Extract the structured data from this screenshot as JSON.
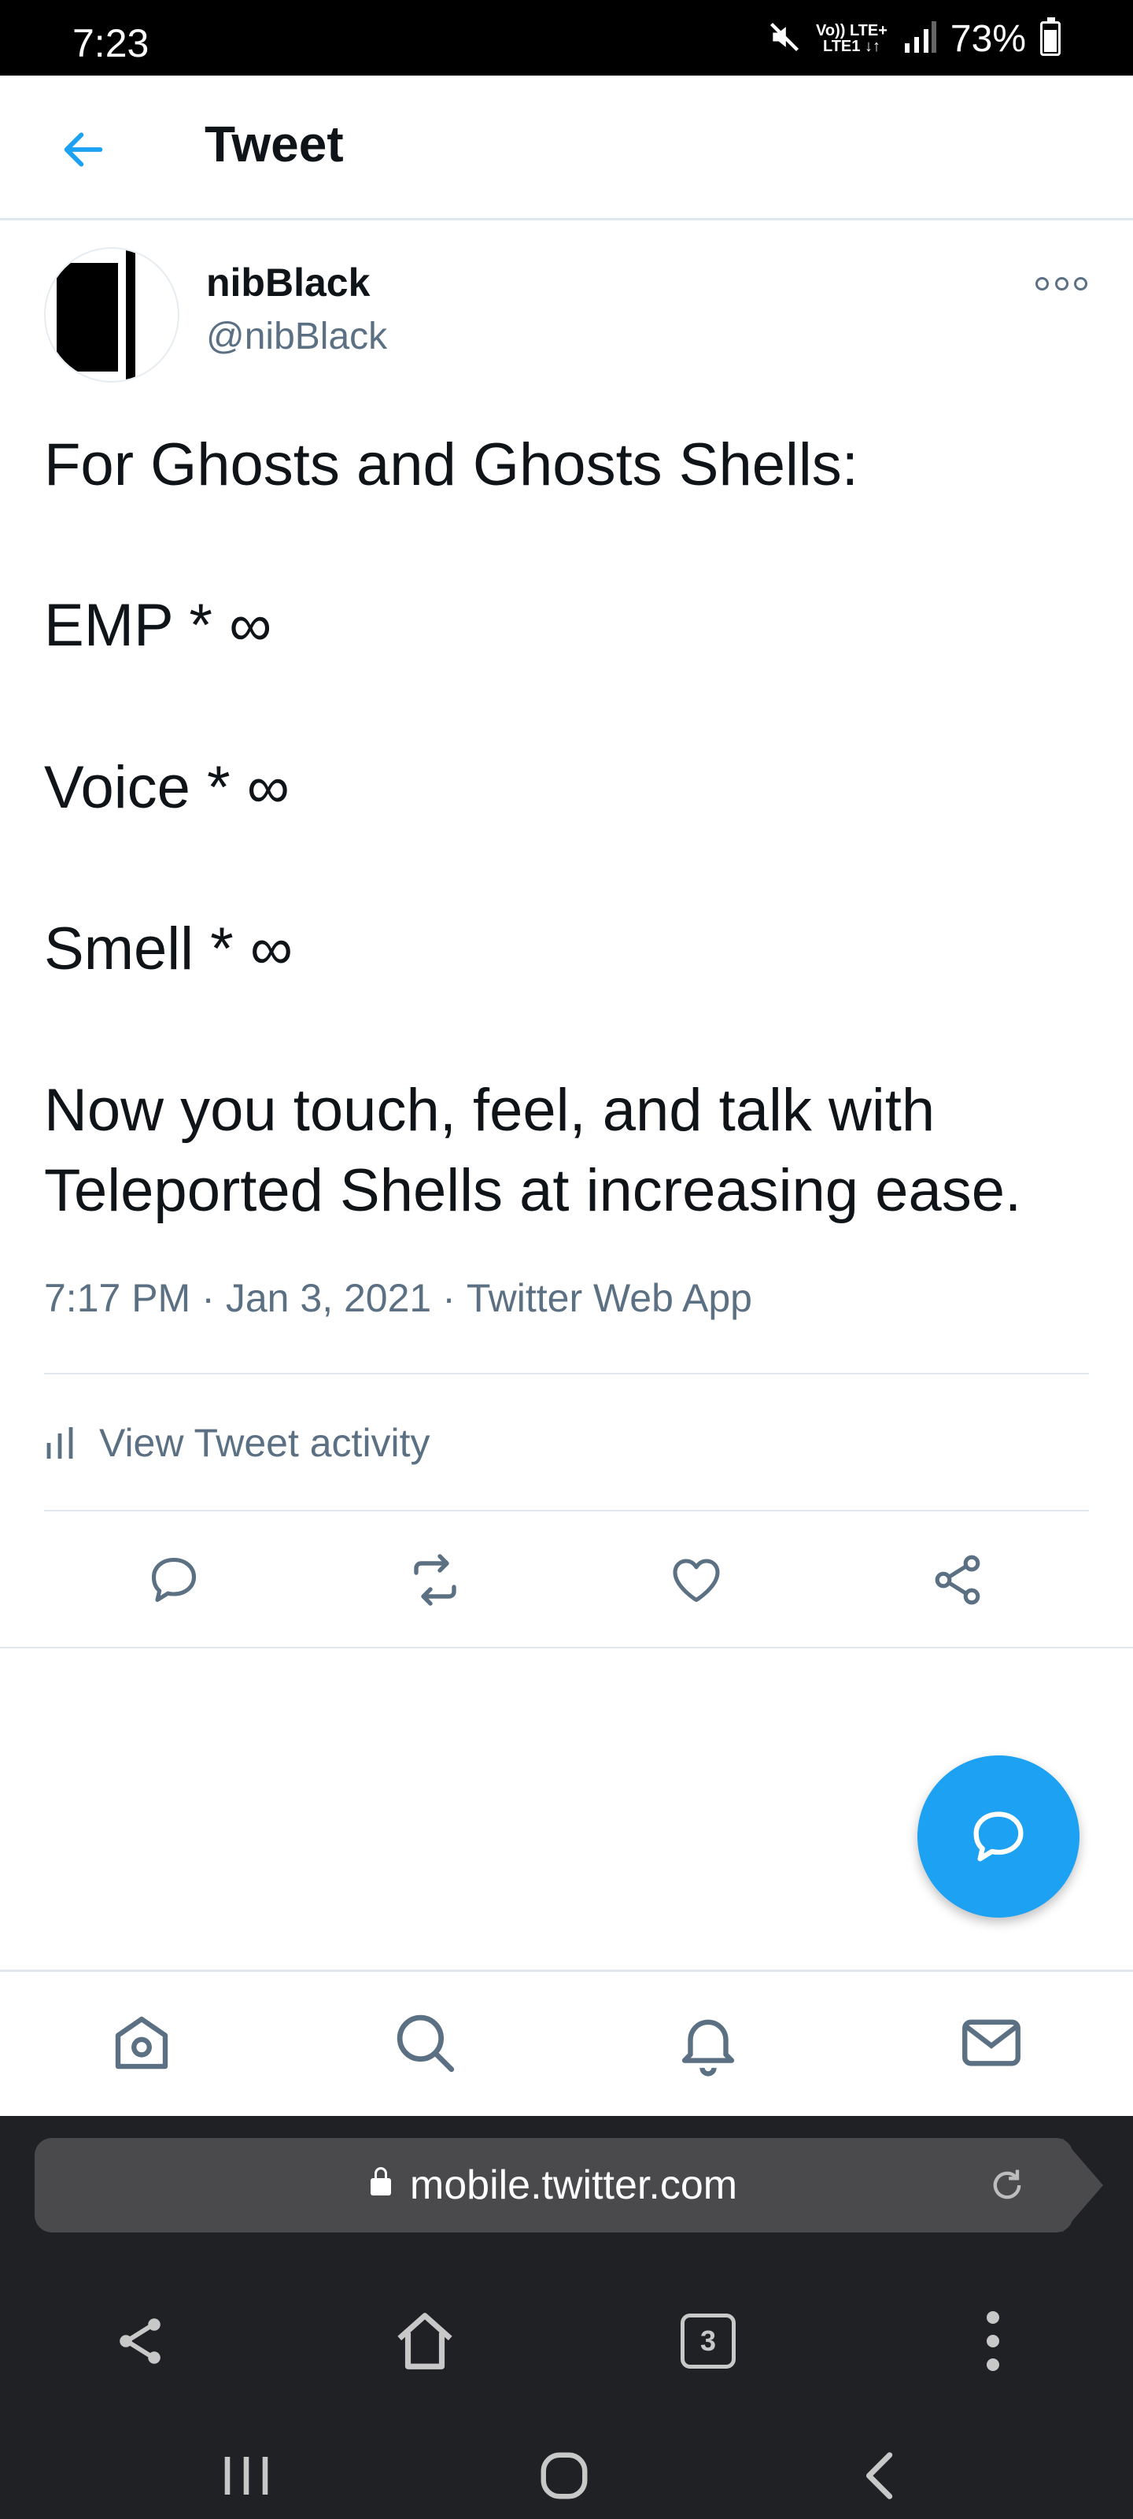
{
  "status_bar": {
    "time": "7:23",
    "network": "Vo)) LTE+\nLTE1 ↓↑",
    "battery": "73%",
    "battery_level": 0.73
  },
  "header": {
    "title": "Tweet"
  },
  "tweet": {
    "user_name": "nibBlack",
    "user_handle": "@nibBlack",
    "lines": [
      "For Ghosts and Ghosts Shells:",
      "EMP * ∞",
      "Voice * ∞",
      "Smell * ∞",
      "Now you touch, feel, and talk with Teleported Shells at increasing ease."
    ],
    "time": "7:17 PM",
    "date": "Jan 3, 2021",
    "source": "Twitter Web App",
    "activity_label": "View Tweet activity"
  },
  "browser": {
    "url": "mobile.twitter.com",
    "tab_count": "3"
  },
  "colors": {
    "accent": "#1da1f2",
    "secondary_text": "#5b7083",
    "divider": "#e1e8ed"
  }
}
